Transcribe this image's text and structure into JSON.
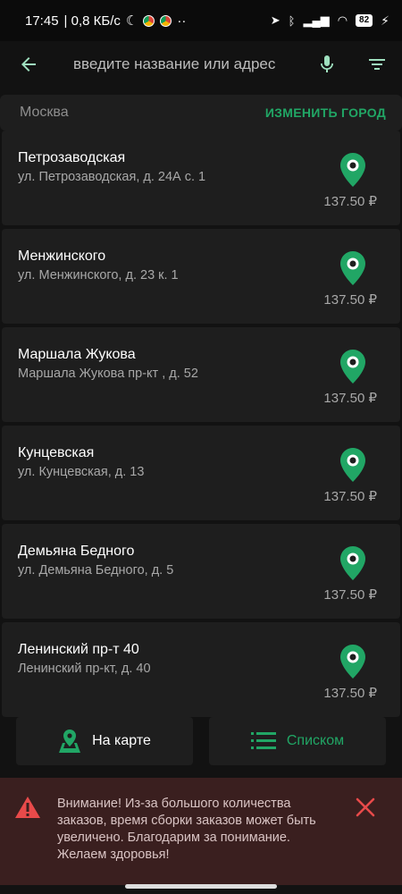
{
  "status": {
    "time": "17:45",
    "speed": "| 0,8 КБ/с",
    "battery": "82"
  },
  "search": {
    "placeholder": "введите название или адрес"
  },
  "city": {
    "name": "Москва",
    "change_label": "ИЗМЕНИТЬ ГОРОД"
  },
  "stores": [
    {
      "name": "Петрозаводская",
      "address": "ул. Петрозаводская, д. 24А с. 1",
      "price": "137.50 ₽"
    },
    {
      "name": "Менжинского",
      "address": "ул. Менжинского, д. 23 к. 1",
      "price": "137.50 ₽"
    },
    {
      "name": "Маршала Жукова",
      "address": "Маршала Жукова пр-кт , д. 52",
      "price": "137.50 ₽"
    },
    {
      "name": "Кунцевская",
      "address": "ул. Кунцевская, д. 13",
      "price": "137.50 ₽"
    },
    {
      "name": "Демьяна Бедного",
      "address": "ул. Демьяна Бедного, д. 5",
      "price": "137.50 ₽"
    },
    {
      "name": "Ленинский пр-т 40",
      "address": "Ленинский пр-кт, д. 40",
      "price": "137.50 ₽"
    }
  ],
  "view": {
    "map_label": "На карте",
    "list_label": "Списком"
  },
  "alert": {
    "message": "Внимание! Из-за большого количества заказов, время сборки заказов может быть увеличено. Благодарим за понимание. Желаем здоровья!"
  },
  "colors": {
    "accent": "#21a665",
    "alert_bg": "#3a1f1f",
    "alert_icon": "#e84a4a"
  }
}
